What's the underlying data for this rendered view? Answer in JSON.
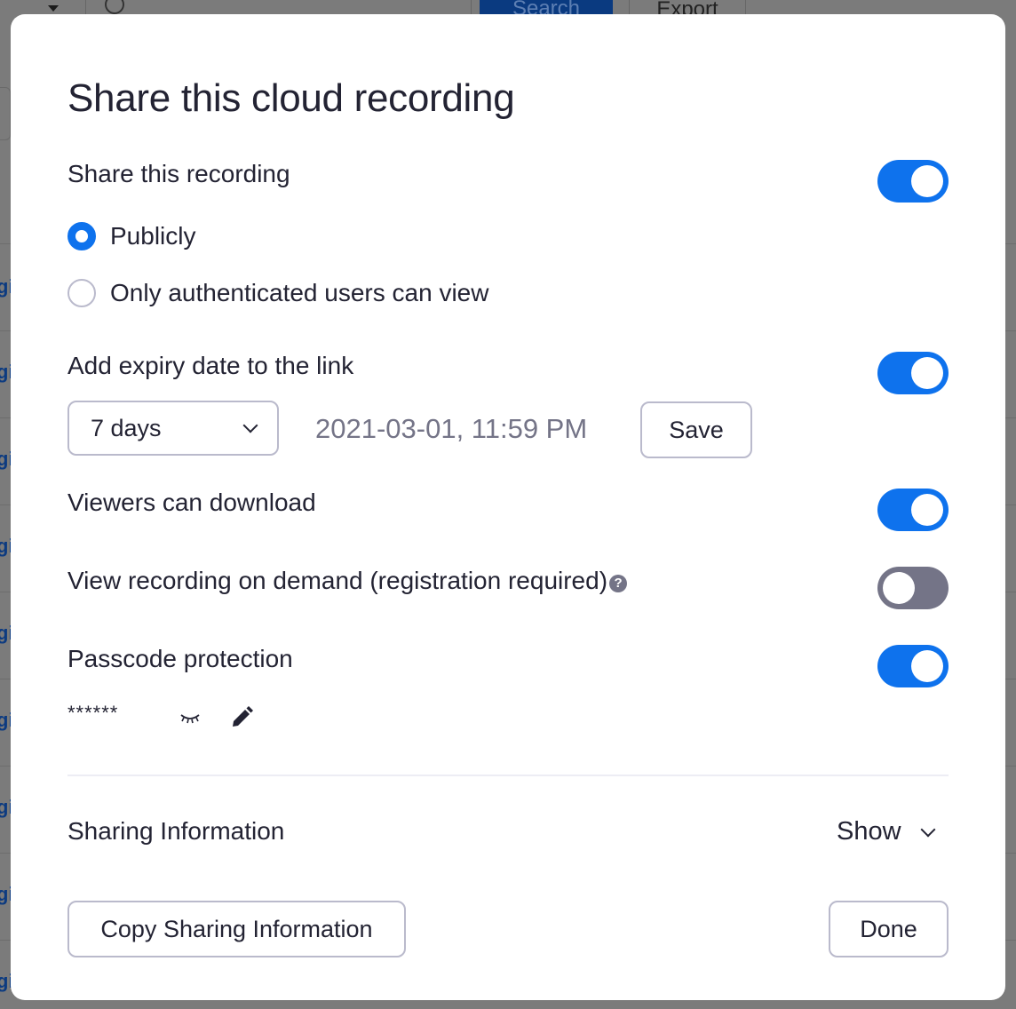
{
  "background": {
    "search_label": "Search",
    "export_label": "Export",
    "row_link_fragment": "gi"
  },
  "dialog": {
    "title": "Share this cloud recording",
    "share_recording": {
      "label": "Share this recording",
      "enabled": true
    },
    "visibility_options": [
      {
        "label": "Publicly",
        "checked": true
      },
      {
        "label": "Only authenticated users can view",
        "checked": false
      }
    ],
    "expiry": {
      "label": "Add expiry date to the link",
      "enabled": true,
      "duration_selected": "7 days",
      "expiry_datetime": "2021-03-01, 11:59 PM",
      "save_label": "Save"
    },
    "viewers_download": {
      "label": "Viewers can download",
      "enabled": true
    },
    "on_demand": {
      "label": "View recording on demand (registration required)",
      "help_icon": "?",
      "enabled": false
    },
    "passcode": {
      "label": "Passcode protection",
      "enabled": true,
      "masked_value": "******"
    },
    "sharing_info": {
      "label": "Sharing Information",
      "toggle_label": "Show"
    },
    "copy_button_label": "Copy Sharing Information",
    "done_button_label": "Done"
  },
  "colors": {
    "accent": "#0e72ed",
    "toggle_off": "#747487",
    "text_primary": "#232333",
    "text_secondary": "#747487",
    "border": "#babacc",
    "overlay": "#7b7b7b"
  }
}
